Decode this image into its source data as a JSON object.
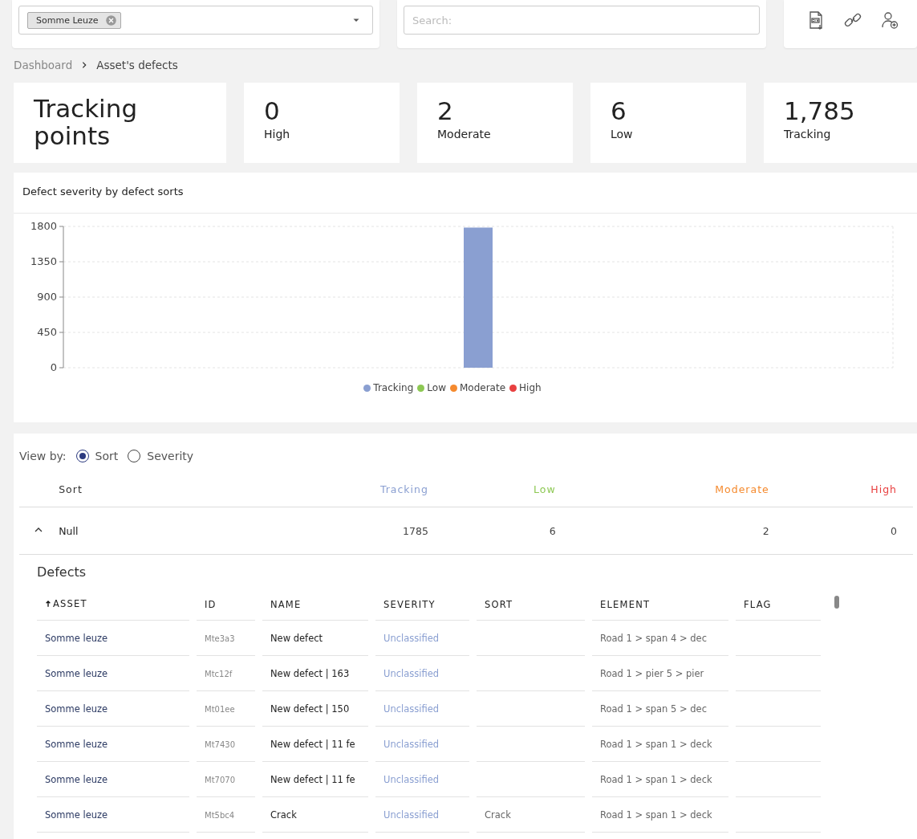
{
  "filters": {
    "asset_tag": "Somme Leuze",
    "search": {
      "placeholder": "Search:"
    }
  },
  "breadcrumb": [
    {
      "label": "Dashboard"
    },
    {
      "label": "Asset's defects"
    }
  ],
  "title_card": {
    "label": "Tracking points"
  },
  "stats": [
    {
      "value": "0",
      "label": "High"
    },
    {
      "value": "2",
      "label": "Moderate"
    },
    {
      "value": "6",
      "label": "Low"
    },
    {
      "value": "1,785",
      "label": "Tracking"
    }
  ],
  "chart": {
    "title": "Defect severity by defect sorts",
    "chart_data": {
      "type": "bar",
      "stacked": true,
      "grid": true,
      "ylim": [
        0,
        1800
      ],
      "yticks": [
        0,
        450,
        900,
        1350,
        1800
      ],
      "series": [
        {
          "name": "Tracking",
          "color": "#8a9fd1",
          "values": [
            1785
          ]
        },
        {
          "name": "Low",
          "color": "#8dc853",
          "values": [
            0
          ]
        },
        {
          "name": "Moderate",
          "color": "#f58a2e",
          "values": [
            0
          ]
        },
        {
          "name": "High",
          "color": "#e84040",
          "values": [
            0
          ]
        }
      ]
    }
  },
  "view_by": {
    "label": "View by:",
    "options": [
      {
        "label": "Sort",
        "selected": true
      },
      {
        "label": "Severity",
        "selected": false
      }
    ]
  },
  "summary": {
    "columns": [
      {
        "label": "Sort"
      },
      {
        "label": "Tracking",
        "color": "#8a9fd1"
      },
      {
        "label": "Low",
        "color": "#8dc853"
      },
      {
        "label": "Moderate",
        "color": "#f58a2e"
      },
      {
        "label": "High",
        "color": "#e84040"
      }
    ],
    "rows": [
      {
        "expanded": true,
        "cells": [
          "Null",
          "1785",
          "6",
          "2",
          "0"
        ]
      }
    ]
  },
  "defects": {
    "title": "Defects",
    "columns": [
      {
        "label": "ASSET",
        "sorted": true
      },
      {
        "label": "ID",
        "sorted": false
      },
      {
        "label": "NAME",
        "sorted": false
      },
      {
        "label": "SEVERITY",
        "sorted": false
      },
      {
        "label": "SORT",
        "sorted": false
      },
      {
        "label": "ELEMENT",
        "sorted": false
      },
      {
        "label": "FLAG",
        "sorted": false
      }
    ],
    "rows": [
      [
        "Somme leuze",
        "Mte3a3",
        "New defect",
        "Unclassified",
        "",
        "Road 1 > span 4 > dec",
        ""
      ],
      [
        "Somme leuze",
        "Mtc12f",
        "New defect | 163",
        "Unclassified",
        "",
        "Road 1 > pier 5 > pier",
        ""
      ],
      [
        "Somme leuze",
        "Mt01ee",
        "New defect | 150",
        "Unclassified",
        "",
        "Road 1 > span 5 > dec",
        ""
      ],
      [
        "Somme leuze",
        "Mt7430",
        "New defect | 11 fe",
        "Unclassified",
        "",
        "Road 1 > span 1 > deck",
        ""
      ],
      [
        "Somme leuze",
        "Mt7070",
        "New defect | 11 fe",
        "Unclassified",
        "",
        "Road 1 > span 1 > deck",
        ""
      ],
      [
        "Somme leuze",
        "Mt5bc4",
        "Crack",
        "Unclassified",
        "Crack",
        "Road 1 > span 1 > deck",
        ""
      ]
    ]
  }
}
